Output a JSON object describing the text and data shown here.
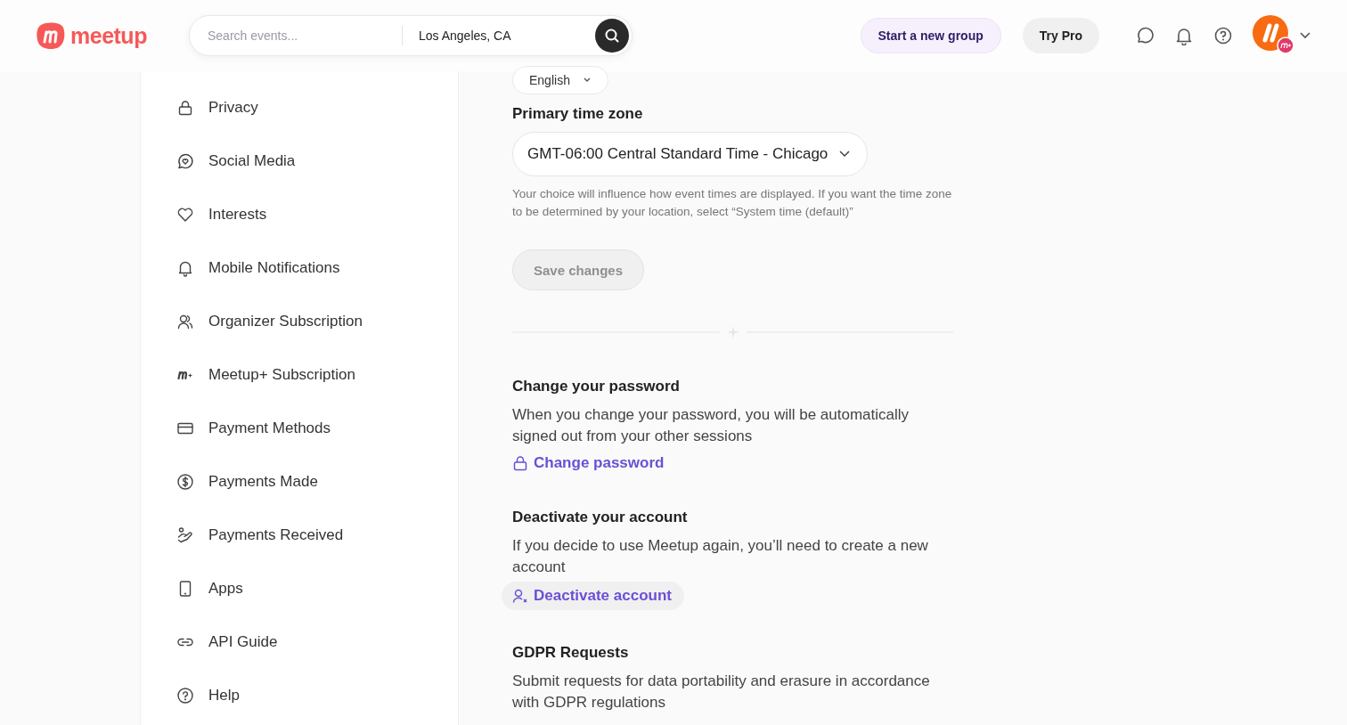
{
  "header": {
    "logo_text": "meetup",
    "search": {
      "placeholder": "Search events...",
      "location": "Los Angeles, CA"
    },
    "buttons": [
      "Start a new group",
      "Try Pro"
    ]
  },
  "sidebar": {
    "items": [
      {
        "label": "Privacy",
        "selected": false
      },
      {
        "label": "Social Media",
        "selected": false
      },
      {
        "label": "Interests",
        "selected": false
      },
      {
        "label": "Mobile Notifications",
        "selected": false
      },
      {
        "label": "Organizer Subscription",
        "selected": false
      },
      {
        "label": "Meetup+ Subscription",
        "selected": false
      },
      {
        "label": "Payment Methods",
        "selected": false
      },
      {
        "label": "Payments Made",
        "selected": false
      },
      {
        "label": "Payments Received",
        "selected": false
      },
      {
        "label": "Apps",
        "selected": false
      },
      {
        "label": "API Guide",
        "selected": false
      },
      {
        "label": "Help",
        "selected": false
      }
    ]
  },
  "settings": {
    "language": {
      "value": "English"
    },
    "time_zone": {
      "label": "Primary time zone",
      "value": "GMT-06:00 Central Standard Time - Chicago",
      "help": "Your choice will influence how event times are displayed. If you want the time zone to be determined by your location, select “System time (default)”"
    },
    "save_button": {
      "label": "Save changes",
      "disabled": true
    }
  },
  "sections": [
    {
      "title": "Change your password",
      "text": "When you change your password, you will be automatically signed out from your other sessions",
      "action": "Change password",
      "kind": "password"
    },
    {
      "title": "Deactivate your account",
      "text": "If you decide to use Meetup again, you’ll need to create a new account",
      "action": "Deactivate account",
      "kind": "deactivate"
    },
    {
      "title": "GDPR Requests",
      "text": "Submit requests for data portability and erasure in accordance with GDPR regulations"
    }
  ]
}
